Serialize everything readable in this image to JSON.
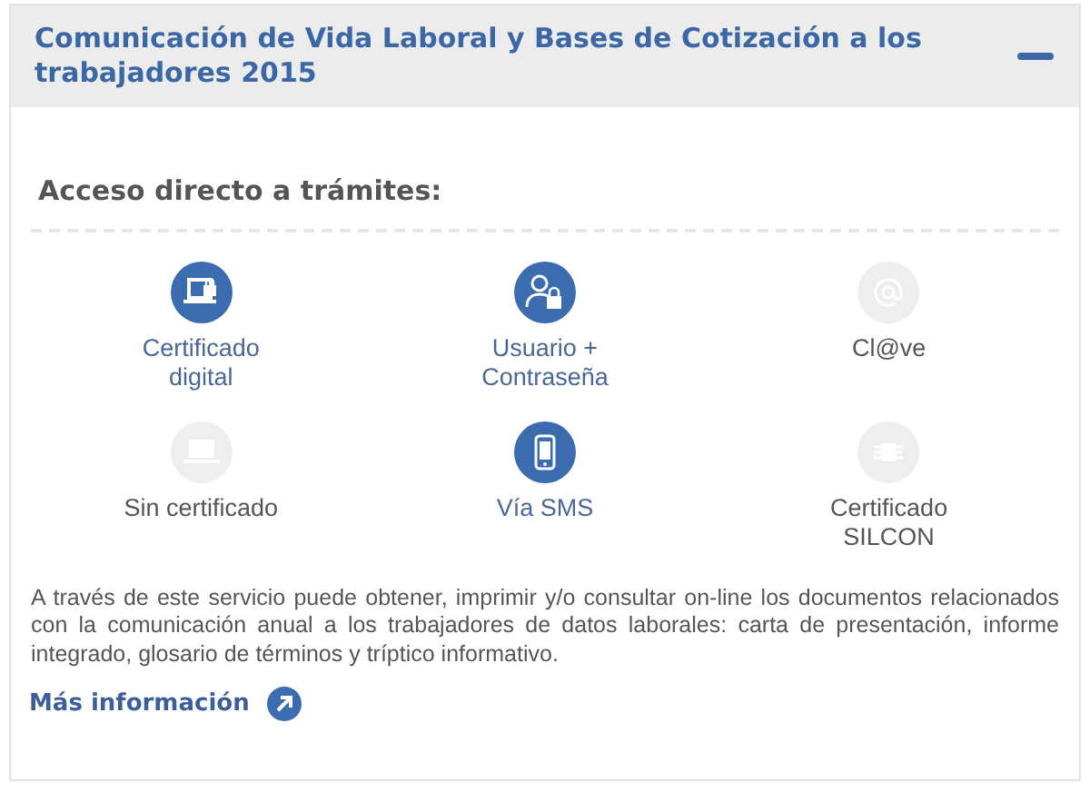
{
  "panel": {
    "title": "Comunicación de Vida Laboral y Bases de Cotización a los trabajadores 2015",
    "expanded": true
  },
  "access": {
    "heading": "Acceso directo a trámites:",
    "items": [
      {
        "label": "Certificado digital",
        "kind": "laptop-lock",
        "enabled": true
      },
      {
        "label": "Usuario + Contraseña",
        "kind": "user-lock",
        "enabled": true
      },
      {
        "label": "Cl@ve",
        "kind": "at",
        "enabled": false
      },
      {
        "label": "Sin certificado",
        "kind": "laptop",
        "enabled": false
      },
      {
        "label": "Vía SMS",
        "kind": "phone",
        "enabled": true
      },
      {
        "label": "Certificado SILCON",
        "kind": "chip",
        "enabled": false
      }
    ]
  },
  "description": "A través de este servicio puede obtener, imprimir y/o consultar on-line los documentos relacionados con la comunicación anual a los trabajadores de datos laborales: carta de presentación, informe integrado, glosario de términos y tríptico informativo.",
  "more_link": "Más información"
}
